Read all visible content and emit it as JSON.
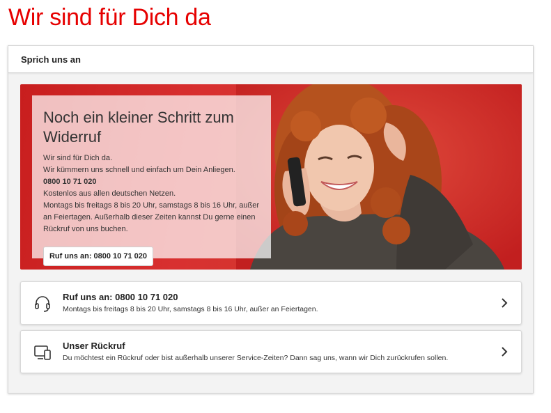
{
  "page": {
    "title": "Wir sind für Dich da"
  },
  "panel": {
    "header": "Sprich uns an"
  },
  "hero": {
    "title": "Noch ein kleiner Schritt zum Widerruf",
    "line1": "Wir sind für Dich da.",
    "line2": "Wir kümmern uns schnell und einfach um Dein Anliegen.",
    "phone": "0800 10 71 020",
    "line3": "Kostenlos aus allen deutschen Netzen.",
    "line4": "Montags bis freitags 8 bis 20 Uhr, samstags 8 bis 16 Uhr, außer an Feiertagen. Außerhalb dieser Zeiten kannst Du gerne einen Rückruf von uns buchen.",
    "button_label": "Ruf uns an: 0800 10 71 020"
  },
  "cards": [
    {
      "title": "Ruf uns an: 0800 10 71 020",
      "subtitle": "Montags bis freitags 8 bis 20 Uhr, samstags 8 bis 16 Uhr, außer an Feiertagen.",
      "icon": "headset-icon"
    },
    {
      "title": "Unser Rückruf",
      "subtitle": "Du möchtest ein Rückruf oder bist außerhalb unserer Service-Zeiten? Dann sag uns, wann wir Dich zurückrufen sollen.",
      "icon": "devices-icon"
    }
  ],
  "colors": {
    "brand": "#e60000",
    "hero_bg": "#d32f2f"
  }
}
